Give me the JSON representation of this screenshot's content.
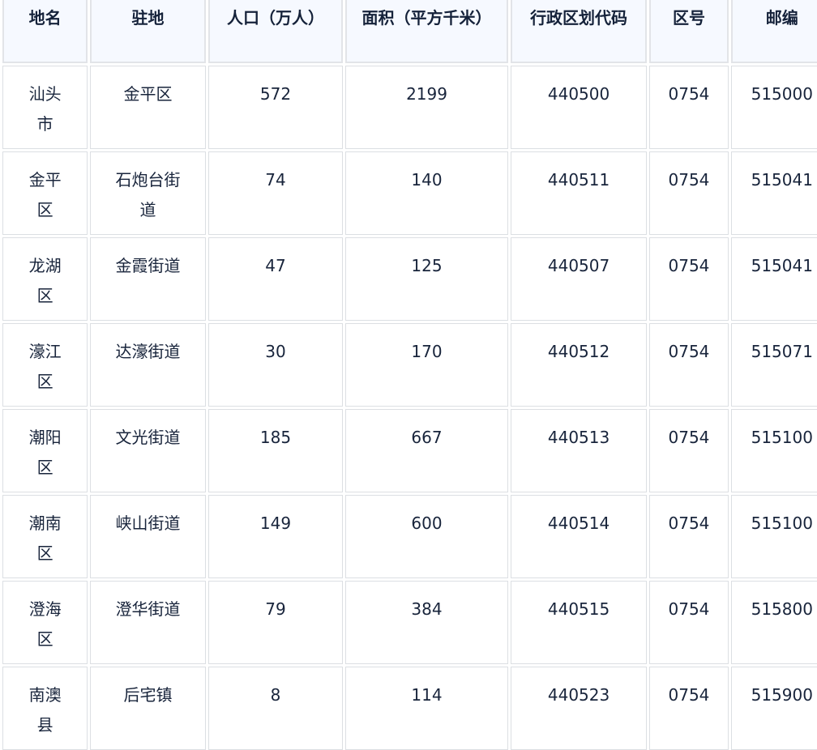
{
  "table": {
    "headers": [
      "地名",
      "驻地",
      "人口（万人）",
      "面积（平方千米）",
      "行政区划代码",
      "区号",
      "邮编"
    ],
    "rows": [
      [
        "汕头市",
        "金平区",
        "572",
        "2199",
        "440500",
        "0754",
        "515000"
      ],
      [
        "金平区",
        "石炮台街道",
        "74",
        "140",
        "440511",
        "0754",
        "515041"
      ],
      [
        "龙湖区",
        "金霞街道",
        "47",
        "125",
        "440507",
        "0754",
        "515041"
      ],
      [
        "濠江区",
        "达濠街道",
        "30",
        "170",
        "440512",
        "0754",
        "515071"
      ],
      [
        "潮阳区",
        "文光街道",
        "185",
        "667",
        "440513",
        "0754",
        "515100"
      ],
      [
        "潮南区",
        "峡山街道",
        "149",
        "600",
        "440514",
        "0754",
        "515100"
      ],
      [
        "澄海区",
        "澄华街道",
        "79",
        "384",
        "440515",
        "0754",
        "515800"
      ],
      [
        "南澳县",
        "后宅镇",
        "8",
        "114",
        "440523",
        "0754",
        "515900"
      ]
    ]
  }
}
